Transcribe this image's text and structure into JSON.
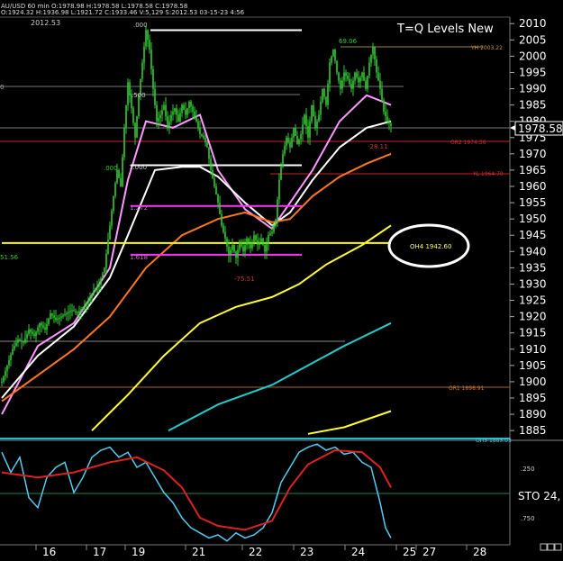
{
  "header": {
    "symbol": "XAUUSD",
    "interval": "60 min",
    "info_line1": "AU/USD 60 min  O:1978.98  H:1978.58  L:1978.58  C:1978.58",
    "info_line2": "O:1924.32  H:1936.98  L:1921.72  C:1933.46  V:5,129  S:2012.53  03-15-23  4:56",
    "corner_value": "2012.53",
    "title": "T=Q Levels New"
  },
  "colors": {
    "background": "#000000",
    "candle": "#33cc33",
    "ema_white": "#ffffff",
    "ema_pink": "#ff99ff",
    "ema_orange": "#ff7722",
    "ema_yellow": "#ffff33",
    "ema_cyan": "#22cccc",
    "level_magenta": "#ff33ff",
    "level_yellow": "#ffff00",
    "level_red": "#cc2222",
    "sto_cyan": "#55ccee",
    "sto_red": "#dd2222",
    "highlight_box": "#ffffff"
  },
  "chart_data": {
    "type": "candlestick",
    "y_axis": {
      "range": [
        1882,
        2012
      ],
      "ticks": [
        2010,
        2005,
        2000,
        1995,
        1990,
        1985,
        1980,
        1975,
        1970,
        1965,
        1960,
        1955,
        1950,
        1945,
        1940,
        1935,
        1930,
        1925,
        1920,
        1915,
        1910,
        1905,
        1900,
        1895,
        1890,
        1885
      ]
    },
    "last_price": 1978.58,
    "x_axis": {
      "ticks": [
        "16",
        "17",
        "19",
        "21",
        "22",
        "23",
        "24",
        "25",
        "27",
        "28"
      ]
    },
    "close_path": [
      [
        0,
        1900
      ],
      [
        6,
        1905
      ],
      [
        12,
        1910
      ],
      [
        18,
        1913
      ],
      [
        24,
        1912
      ],
      [
        30,
        1916
      ],
      [
        36,
        1914
      ],
      [
        42,
        1918
      ],
      [
        48,
        1916
      ],
      [
        54,
        1921
      ],
      [
        60,
        1919
      ],
      [
        66,
        1920
      ],
      [
        72,
        1921
      ],
      [
        78,
        1922
      ],
      [
        84,
        1921
      ],
      [
        90,
        1923
      ],
      [
        96,
        1925
      ],
      [
        102,
        1928
      ],
      [
        108,
        1930
      ],
      [
        114,
        1935
      ],
      [
        120,
        1948
      ],
      [
        124,
        1957
      ],
      [
        128,
        1965
      ],
      [
        132,
        1960
      ],
      [
        136,
        1978
      ],
      [
        140,
        1992
      ],
      [
        144,
        1984
      ],
      [
        148,
        1975
      ],
      [
        152,
        1988
      ],
      [
        156,
        1998
      ],
      [
        160,
        2008
      ],
      [
        164,
        2002
      ],
      [
        168,
        1990
      ],
      [
        172,
        1980
      ],
      [
        176,
        1982
      ],
      [
        180,
        1985
      ],
      [
        184,
        1978
      ],
      [
        188,
        1982
      ],
      [
        192,
        1984
      ],
      [
        196,
        1980
      ],
      [
        200,
        1985
      ],
      [
        204,
        1982
      ],
      [
        208,
        1986
      ],
      [
        212,
        1983
      ],
      [
        216,
        1980
      ],
      [
        220,
        1976
      ],
      [
        224,
        1975
      ],
      [
        228,
        1972
      ],
      [
        232,
        1965
      ],
      [
        236,
        1960
      ],
      [
        240,
        1955
      ],
      [
        244,
        1948
      ],
      [
        248,
        1944
      ],
      [
        252,
        1939
      ],
      [
        256,
        1942
      ],
      [
        260,
        1938
      ],
      [
        264,
        1943
      ],
      [
        268,
        1940
      ],
      [
        272,
        1944
      ],
      [
        276,
        1941
      ],
      [
        280,
        1945
      ],
      [
        284,
        1942
      ],
      [
        288,
        1944
      ],
      [
        292,
        1940
      ],
      [
        296,
        1945
      ],
      [
        300,
        1946
      ],
      [
        304,
        1950
      ],
      [
        308,
        1962
      ],
      [
        312,
        1970
      ],
      [
        316,
        1975
      ],
      [
        320,
        1972
      ],
      [
        324,
        1978
      ],
      [
        328,
        1973
      ],
      [
        332,
        1976
      ],
      [
        336,
        1982
      ],
      [
        340,
        1975
      ],
      [
        344,
        1985
      ],
      [
        348,
        1978
      ],
      [
        352,
        1982
      ],
      [
        356,
        1990
      ],
      [
        360,
        1985
      ],
      [
        364,
        1998
      ],
      [
        368,
        2002
      ],
      [
        372,
        1995
      ],
      [
        376,
        1990
      ],
      [
        380,
        1995
      ],
      [
        384,
        1993
      ],
      [
        388,
        1990
      ],
      [
        392,
        1995
      ],
      [
        396,
        1992
      ],
      [
        400,
        1995
      ],
      [
        404,
        1990
      ],
      [
        408,
        1998
      ],
      [
        412,
        2003
      ],
      [
        416,
        1995
      ],
      [
        420,
        1990
      ],
      [
        424,
        1983
      ],
      [
        428,
        1980
      ],
      [
        432,
        1978.58
      ]
    ],
    "series": [
      {
        "role": "ema_pink",
        "points": [
          [
            0,
            1890
          ],
          [
            40,
            1911
          ],
          [
            80,
            1918
          ],
          [
            120,
            1935
          ],
          [
            140,
            1962
          ],
          [
            160,
            1980
          ],
          [
            190,
            1978
          ],
          [
            220,
            1982
          ],
          [
            240,
            1965
          ],
          [
            270,
            1953
          ],
          [
            300,
            1947
          ],
          [
            320,
            1955
          ],
          [
            345,
            1965
          ],
          [
            375,
            1980
          ],
          [
            405,
            1988
          ],
          [
            432,
            1985
          ]
        ]
      },
      {
        "role": "ema_white",
        "points": [
          [
            0,
            1895
          ],
          [
            40,
            1908
          ],
          [
            80,
            1917
          ],
          [
            120,
            1932
          ],
          [
            140,
            1945
          ],
          [
            170,
            1965
          ],
          [
            200,
            1966
          ],
          [
            220,
            1966
          ],
          [
            240,
            1963
          ],
          [
            270,
            1955
          ],
          [
            300,
            1948
          ],
          [
            320,
            1952
          ],
          [
            345,
            1962
          ],
          [
            375,
            1972
          ],
          [
            405,
            1978
          ],
          [
            432,
            1980
          ]
        ]
      },
      {
        "role": "ema_orange",
        "points": [
          [
            0,
            1894
          ],
          [
            40,
            1902
          ],
          [
            80,
            1910
          ],
          [
            120,
            1920
          ],
          [
            160,
            1935
          ],
          [
            200,
            1945
          ],
          [
            240,
            1950
          ],
          [
            270,
            1952
          ],
          [
            300,
            1949
          ],
          [
            320,
            1950
          ],
          [
            345,
            1957
          ],
          [
            375,
            1963
          ],
          [
            405,
            1967
          ],
          [
            432,
            1970
          ]
        ]
      },
      {
        "role": "ema_yellow",
        "points": [
          [
            100,
            1885
          ],
          [
            140,
            1896
          ],
          [
            180,
            1908
          ],
          [
            220,
            1918
          ],
          [
            260,
            1923
          ],
          [
            300,
            1926
          ],
          [
            330,
            1930
          ],
          [
            360,
            1936
          ],
          [
            400,
            1942
          ],
          [
            432,
            1948
          ]
        ]
      },
      {
        "role": "ema_cyan",
        "points": [
          [
            185,
            1885
          ],
          [
            240,
            1893
          ],
          [
            300,
            1899
          ],
          [
            340,
            1905
          ],
          [
            380,
            1911
          ],
          [
            432,
            1918
          ]
        ]
      },
      {
        "role": "ema_yellow",
        "points": [
          [
            340,
            1884
          ],
          [
            380,
            1886
          ],
          [
            432,
            1891
          ]
        ]
      }
    ],
    "levels": [
      {
        "role": "level_magenta",
        "x_start": 143,
        "x_end": 333,
        "y": 1954
      },
      {
        "role": "level_magenta",
        "x_start": 143,
        "x_end": 333,
        "y": 1939
      },
      {
        "role": "level_yellow",
        "x_start": 0,
        "x_end": 432,
        "y": 1942.6
      },
      {
        "role": "ema_white",
        "x_start": 143,
        "x_end": 333,
        "y": 1966.5
      },
      {
        "role": "ema_white",
        "x_start": 165,
        "x_end": 333,
        "y": 2008
      }
    ],
    "sto_panel": {
      "ticks": [
        ".250",
        ".750"
      ],
      "label": "STO 24,",
      "cyan": [
        [
          0,
          0.1
        ],
        [
          10,
          0.3
        ],
        [
          20,
          0.15
        ],
        [
          30,
          0.55
        ],
        [
          40,
          0.65
        ],
        [
          50,
          0.35
        ],
        [
          60,
          0.25
        ],
        [
          70,
          0.2
        ],
        [
          80,
          0.5
        ],
        [
          90,
          0.35
        ],
        [
          100,
          0.15
        ],
        [
          110,
          0.08
        ],
        [
          120,
          0.05
        ],
        [
          130,
          0.15
        ],
        [
          140,
          0.1
        ],
        [
          150,
          0.25
        ],
        [
          160,
          0.2
        ],
        [
          170,
          0.35
        ],
        [
          180,
          0.5
        ],
        [
          190,
          0.6
        ],
        [
          200,
          0.75
        ],
        [
          210,
          0.85
        ],
        [
          220,
          0.9
        ],
        [
          230,
          0.95
        ],
        [
          240,
          0.92
        ],
        [
          250,
          0.98
        ],
        [
          260,
          0.9
        ],
        [
          270,
          0.95
        ],
        [
          280,
          0.92
        ],
        [
          290,
          0.85
        ],
        [
          300,
          0.7
        ],
        [
          310,
          0.4
        ],
        [
          320,
          0.25
        ],
        [
          330,
          0.1
        ],
        [
          340,
          0.05
        ],
        [
          350,
          0.02
        ],
        [
          360,
          0.08
        ],
        [
          370,
          0.05
        ],
        [
          380,
          0.12
        ],
        [
          390,
          0.1
        ],
        [
          400,
          0.2
        ],
        [
          410,
          0.25
        ],
        [
          420,
          0.6
        ],
        [
          426,
          0.85
        ],
        [
          432,
          0.95
        ]
      ],
      "red": [
        [
          0,
          0.3
        ],
        [
          40,
          0.35
        ],
        [
          80,
          0.3
        ],
        [
          120,
          0.2
        ],
        [
          150,
          0.15
        ],
        [
          180,
          0.28
        ],
        [
          200,
          0.45
        ],
        [
          220,
          0.75
        ],
        [
          240,
          0.83
        ],
        [
          270,
          0.87
        ],
        [
          300,
          0.78
        ],
        [
          320,
          0.45
        ],
        [
          340,
          0.22
        ],
        [
          370,
          0.08
        ],
        [
          400,
          0.1
        ],
        [
          420,
          0.25
        ],
        [
          432,
          0.45
        ]
      ]
    }
  },
  "labels": {
    "fib_000": ".000",
    "fib_500": ".500",
    "fib_1000": "1.000",
    "fib_1272": "1.272",
    "fib_1618": "1.618",
    "left_000": ".000",
    "left_5156": "51.56",
    "left_0": "0",
    "high_6906": "69.06",
    "yh": "YH 2003.22",
    "or2": "OR2 1974.36",
    "yl": "YL 1964.70",
    "oh4": "OH4 1942.60",
    "or1": "OR1 1898.91",
    "oh3": "OH3 1883.03",
    "neg_2811": "-28.11",
    "neg_7551": "-75.51",
    "price_marker": "1978.58"
  }
}
